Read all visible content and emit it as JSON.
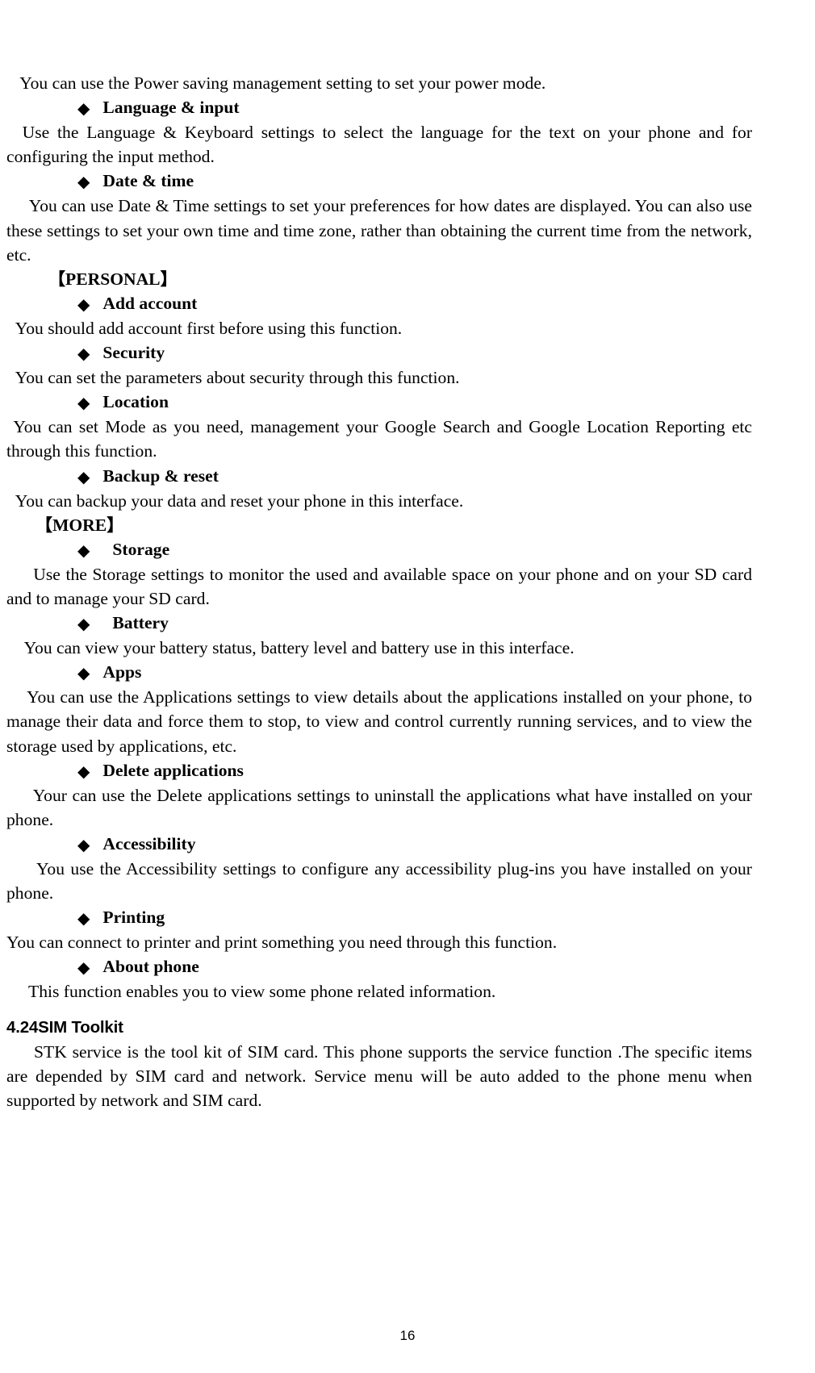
{
  "document": {
    "page_number": "16",
    "blocks": [
      {
        "kind": "paragraph",
        "indent": "para",
        "text": "   You can use the Power saving management setting to set your power mode."
      },
      {
        "kind": "bullet",
        "bullet": "◆",
        "label": "Language & input",
        "indent": "bullet"
      },
      {
        "kind": "paragraph",
        "indent": "para",
        "text": "  Use the Language & Keyboard settings to select the language for the text on your phone and for configuring the input method."
      },
      {
        "kind": "bullet",
        "bullet": "◆",
        "label": "Date & time",
        "indent": "bullet"
      },
      {
        "kind": "paragraph",
        "indent": "para",
        "text": "     You can use Date & Time settings to set your preferences for how dates are displayed. You can also use these settings to set your own time and time zone, rather than obtaining the current time from the network, etc."
      },
      {
        "kind": "group",
        "open_bracket": "【",
        "label": "PERSONAL",
        "close_bracket": "】",
        "indent": "group-personal"
      },
      {
        "kind": "bullet",
        "bullet": "◆",
        "label": "Add account",
        "indent": "bullet"
      },
      {
        "kind": "paragraph",
        "indent": "para",
        "text": "  You should add account first before using this function."
      },
      {
        "kind": "bullet",
        "bullet": "◆",
        "label": "Security",
        "indent": "bullet"
      },
      {
        "kind": "paragraph",
        "indent": "para",
        "text": "  You can set the parameters about security through this function."
      },
      {
        "kind": "bullet",
        "bullet": "◆",
        "label": "Location",
        "indent": "bullet"
      },
      {
        "kind": "paragraph",
        "indent": "para",
        "text": " You can set Mode as you need, management your Google Search and Google Location Reporting etc through this function."
      },
      {
        "kind": "bullet",
        "bullet": "◆",
        "label": "Backup & reset",
        "indent": "bullet"
      },
      {
        "kind": "paragraph",
        "indent": "para",
        "text": "  You can backup your data and reset your phone in this interface."
      },
      {
        "kind": "group",
        "open_bracket": "【",
        "label": "MORE",
        "close_bracket": "】",
        "indent": "group-more"
      },
      {
        "kind": "bullet",
        "bullet": "◆",
        "label": "Storage",
        "indent": "bullet-wide"
      },
      {
        "kind": "paragraph",
        "indent": "para",
        "text": "     Use the Storage settings to monitor the used and available space on your phone and on your SD card and to manage your SD card."
      },
      {
        "kind": "bullet",
        "bullet": "◆",
        "label": "Battery",
        "indent": "bullet-wide"
      },
      {
        "kind": "paragraph",
        "indent": "para",
        "text": "    You can view your battery status, battery level and battery use in this interface."
      },
      {
        "kind": "bullet",
        "bullet": "◆",
        "label": "Apps",
        "indent": "bullet"
      },
      {
        "kind": "paragraph",
        "indent": "para",
        "text": "    You can use the Applications settings to view details about the applications installed on your phone, to manage their data and force them to stop, to view and control currently running services, and to view the storage used by applications, etc."
      },
      {
        "kind": "bullet",
        "bullet": "◆",
        "label": "Delete applications",
        "indent": "bullet"
      },
      {
        "kind": "paragraph",
        "indent": "para",
        "text": "     Your can use the Delete applications settings to uninstall the applications what have installed on your phone."
      },
      {
        "kind": "bullet",
        "bullet": "◆",
        "label": "Accessibility",
        "indent": "bullet"
      },
      {
        "kind": "paragraph",
        "indent": "para",
        "text": "     You use the Accessibility settings to configure any accessibility plug-ins you have installed on your phone."
      },
      {
        "kind": "bullet",
        "bullet": "◆",
        "label": "Printing",
        "indent": "bullet"
      },
      {
        "kind": "paragraph",
        "indent": "para",
        "text": "You can connect to printer and print something you need through this function."
      },
      {
        "kind": "bullet",
        "bullet": "◆",
        "label": "About phone",
        "indent": "bullet"
      },
      {
        "kind": "paragraph",
        "indent": "para",
        "text": "     This function enables you to view some phone related information."
      },
      {
        "kind": "section-heading",
        "text": "4.24SIM Toolkit"
      },
      {
        "kind": "paragraph",
        "indent": "para",
        "text": "     STK service is the tool kit of SIM card. This phone supports the service function .The specific items are depended by SIM card and network. Service menu will be auto added to the phone menu when supported by network and SIM card."
      }
    ]
  }
}
